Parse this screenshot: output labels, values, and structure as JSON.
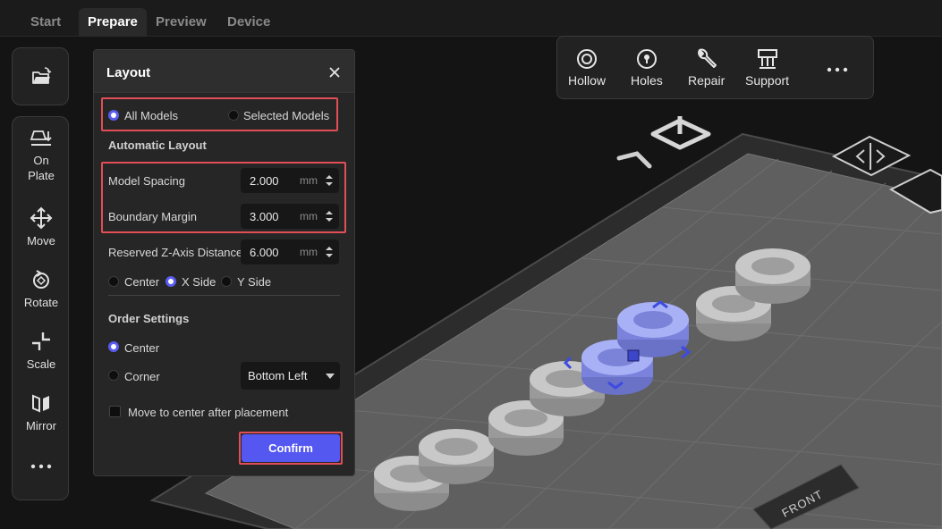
{
  "tabs": [
    {
      "label": "Start"
    },
    {
      "label": "Prepare"
    },
    {
      "label": "Preview"
    },
    {
      "label": "Device"
    }
  ],
  "left_toolbar": {
    "items": [
      {
        "icon": "on-plate-icon",
        "label_line1": "On",
        "label_line2": "Plate"
      },
      {
        "icon": "move-icon",
        "label": "Move"
      },
      {
        "icon": "rotate-icon",
        "label": "Rotate"
      },
      {
        "icon": "scale-icon",
        "label": "Scale"
      },
      {
        "icon": "mirror-icon",
        "label": "Mirror"
      }
    ],
    "open_icon": "open-folder-icon",
    "more_icon": "more-icon"
  },
  "top_toolbar": {
    "items": [
      {
        "icon": "hollow-icon",
        "label": "Hollow"
      },
      {
        "icon": "holes-icon",
        "label": "Holes"
      },
      {
        "icon": "repair-icon",
        "label": "Repair"
      },
      {
        "icon": "support-icon",
        "label": "Support"
      }
    ],
    "more_icon": "more-icon"
  },
  "layout_panel": {
    "title": "Layout",
    "scope": {
      "all_models": "All Models",
      "selected_models": "Selected Models",
      "selected": "All Models"
    },
    "automatic_layout_title": "Automatic Layout",
    "fields": {
      "model_spacing": {
        "label": "Model Spacing",
        "value": "2.000",
        "unit": "mm"
      },
      "boundary_margin": {
        "label": "Boundary Margin",
        "value": "3.000",
        "unit": "mm"
      },
      "reserved_z": {
        "label": "Reserved Z-Axis Distance",
        "value": "6.000",
        "unit": "mm"
      }
    },
    "placement": {
      "center": "Center",
      "x_side": "X Side",
      "y_side": "Y Side",
      "selected": "X Side"
    },
    "order_settings_title": "Order Settings",
    "order": {
      "center": "Center",
      "corner": "Corner",
      "selected": "Center",
      "corner_value": "Bottom Left"
    },
    "move_to_center": {
      "label": "Move to center after placement",
      "checked": false
    },
    "confirm": "Confirm"
  },
  "viewport": {
    "plate_label": "FRONT",
    "accent_color": "#5457f0",
    "highlight_color": "#e24e55"
  }
}
